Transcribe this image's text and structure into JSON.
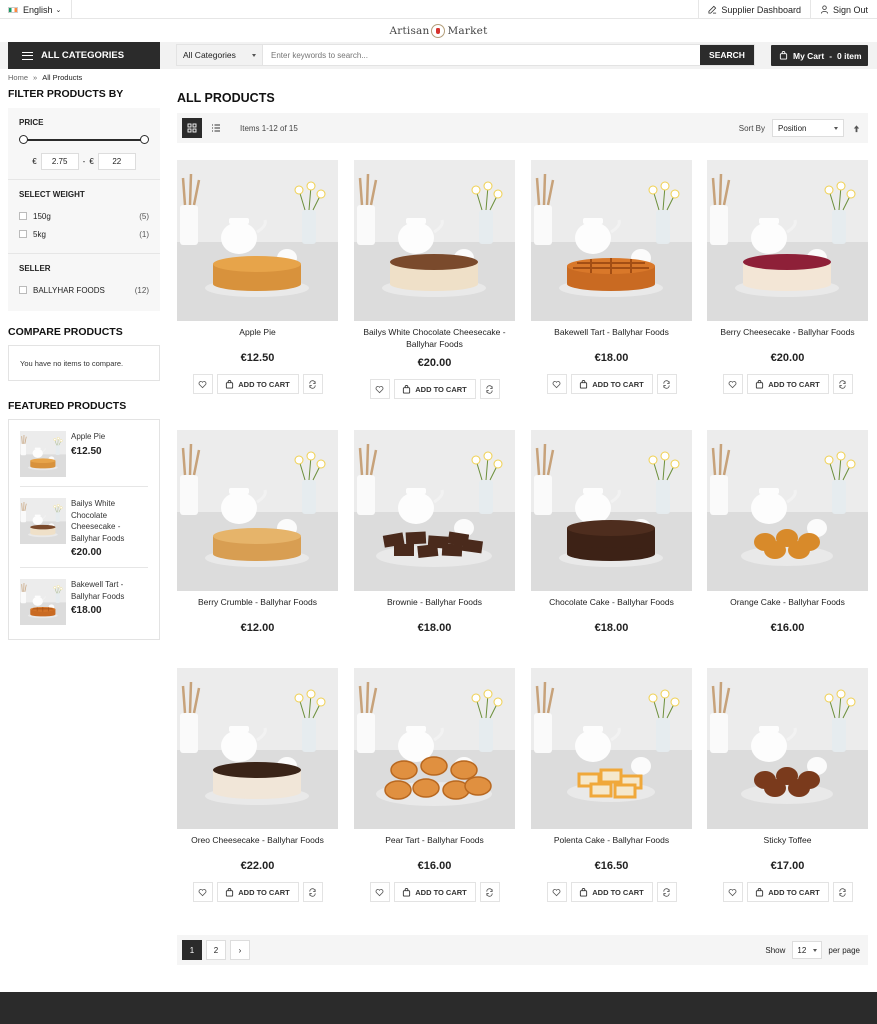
{
  "topbar": {
    "language": "English",
    "supplier_dashboard": "Supplier Dashboard",
    "sign_out": "Sign Out"
  },
  "logo": {
    "left": "Artisan",
    "right": "Market"
  },
  "nav": {
    "all_categories": "ALL CATEGORIES",
    "search_category": "All Categories",
    "search_placeholder": "Enter keywords to search...",
    "search_button": "SEARCH",
    "cart_label": "My Cart",
    "cart_count": "0 item"
  },
  "breadcrumb": {
    "home": "Home",
    "sep": "»",
    "current": "All Products"
  },
  "sidebar": {
    "filter_title": "FILTER PRODUCTS BY",
    "price_title": "PRICE",
    "currency": "€",
    "price_min": "2.75",
    "price_max": "22",
    "price_sep": "-",
    "weight_title": "SELECT WEIGHT",
    "weights": [
      {
        "label": "150g",
        "count": "(5)"
      },
      {
        "label": "5kg",
        "count": "(1)"
      }
    ],
    "seller_title": "SELLER",
    "sellers": [
      {
        "label": "BALLYHAR FOODS",
        "count": "(12)"
      }
    ],
    "compare_title": "COMPARE PRODUCTS",
    "compare_empty": "You have no items to compare.",
    "featured_title": "FEATURED PRODUCTS",
    "featured": [
      {
        "name": "Apple Pie",
        "price": "€12.50"
      },
      {
        "name": "Bailys White Chocolate Cheesecake - Ballyhar Foods",
        "price": "€20.00"
      },
      {
        "name": "Bakewell Tart - Ballyhar Foods",
        "price": "€18.00"
      }
    ]
  },
  "main": {
    "title": "ALL PRODUCTS",
    "items_count": "Items 1-12 of 15",
    "sort_label": "Sort By",
    "sort_value": "Position",
    "add_to_cart": "ADD TO CART",
    "products": [
      {
        "name": "Apple Pie",
        "price": "€12.50"
      },
      {
        "name": "Bailys White Chocolate Cheesecake - Ballyhar Foods",
        "price": "€20.00"
      },
      {
        "name": "Bakewell Tart - Ballyhar Foods",
        "price": "€18.00"
      },
      {
        "name": "Berry Cheesecake - Ballyhar Foods",
        "price": "€20.00"
      },
      {
        "name": "Berry Crumble - Ballyhar Foods",
        "price": "€12.00"
      },
      {
        "name": "Brownie - Ballyhar Foods",
        "price": "€18.00"
      },
      {
        "name": "Chocolate Cake - Ballyhar Foods",
        "price": "€18.00"
      },
      {
        "name": "Orange Cake - Ballyhar Foods",
        "price": "€16.00"
      },
      {
        "name": "Oreo Cheesecake - Ballyhar Foods",
        "price": "€22.00"
      },
      {
        "name": "Pear Tart - Ballyhar Foods",
        "price": "€16.00"
      },
      {
        "name": "Polenta Cake - Ballyhar Foods",
        "price": "€16.50"
      },
      {
        "name": "Sticky Toffee",
        "price": "€17.00"
      }
    ]
  },
  "pager": {
    "pages": [
      "1",
      "2"
    ],
    "next": "›",
    "show_label": "Show",
    "limit": "12",
    "per_page": "per page"
  },
  "colors": {
    "dark": "#2b2b2b",
    "toolbar": "#f5f5f5"
  }
}
